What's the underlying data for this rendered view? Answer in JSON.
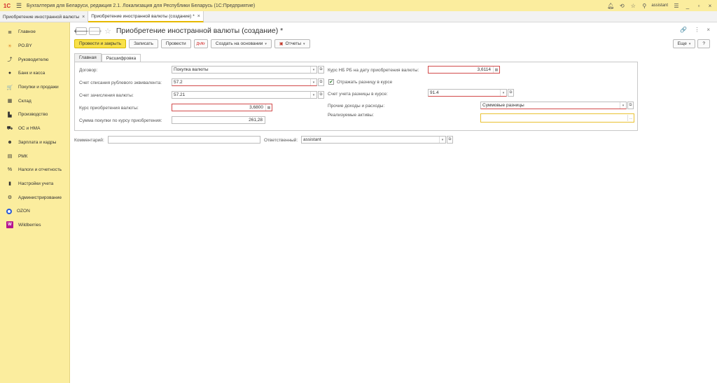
{
  "app": {
    "logo": "1С",
    "title": "Бухгалтерия для Беларуси, редакция 2.1. Локализация для Республики Беларусь   (1С:Предприятие)",
    "user": "assistant"
  },
  "open_tabs": [
    {
      "label": "Приобретение иностранной валюты",
      "close": "×"
    },
    {
      "label": "Приобретение иностранной валюты (создание) *",
      "close": "×"
    }
  ],
  "sidebar": {
    "items": [
      {
        "label": "Главное",
        "icon": "≣"
      },
      {
        "label": "РО.BY",
        "icon": "☀"
      },
      {
        "label": "Руководителю",
        "icon": "⤴"
      },
      {
        "label": "Банк и касса",
        "icon": "●"
      },
      {
        "label": "Покупки и продажи",
        "icon": "🛒"
      },
      {
        "label": "Склад",
        "icon": "▦"
      },
      {
        "label": "Производство",
        "icon": "▙"
      },
      {
        "label": "ОС и НМА",
        "icon": "⛟"
      },
      {
        "label": "Зарплата и кадры",
        "icon": "☻"
      },
      {
        "label": "РМК",
        "icon": "▤"
      },
      {
        "label": "Налоги и отчетность",
        "icon": "%"
      },
      {
        "label": "Настройки учета",
        "icon": "▮"
      },
      {
        "label": "Администрирование",
        "icon": "⚙"
      },
      {
        "label": "OZON",
        "icon": ""
      },
      {
        "label": "Wildberries",
        "icon": "W"
      }
    ]
  },
  "document": {
    "title": "Приобретение иностранной валюты (создание) *",
    "nav_back": "🡐",
    "nav_forward": "🡒",
    "favorite": "☆",
    "link_icon": "🔗",
    "more_icon": "⋮",
    "close_icon": "×"
  },
  "toolbar": {
    "post_close": "Провести и закрыть",
    "save": "Записать",
    "post": "Провести",
    "dt_kt": "Дт/Кт",
    "create_based": "Создать на основании",
    "reports": "Отчеты",
    "more": "Еще",
    "help": "?"
  },
  "form_tabs": [
    "Главная",
    "Расшифровка"
  ],
  "fields": {
    "contract_label": "Договор:",
    "contract_value": "Покупка валюты",
    "debit_account_label": "Счет списания рублевого эквивалента:",
    "debit_account_value": "57.2",
    "credit_account_label": "Счет зачисления валюты:",
    "credit_account_value": "57.21",
    "purchase_rate_label": "Курс приобретения валюты:",
    "purchase_rate_value": "3,6800",
    "purchase_sum_label": "Сумма покупки  по курсу приобретения:",
    "purchase_sum_value": "261,28",
    "nb_rate_label": "Курс НБ РБ на дату приобретения валюты:",
    "nb_rate_value": "3,6114",
    "reflect_diff_label": "Отражать разницу в курсе",
    "reflect_diff_checked": true,
    "diff_account_label": "Счет учета разницы в курсе:",
    "diff_account_value": "91.4",
    "other_income_label": "Прочие доходы и расходы:",
    "other_income_value": "Суммовые разницы",
    "assets_label": "Реализуемые активы:",
    "assets_value": ""
  },
  "footer": {
    "comment_label": "Комментарий:",
    "comment_value": "",
    "responsible_label": "Ответственный:",
    "responsible_value": "assistant"
  },
  "colors": {
    "accent_yellow": "#fbed9e",
    "primary_button": "#f9e14a",
    "required_red": "#d24b4b"
  }
}
